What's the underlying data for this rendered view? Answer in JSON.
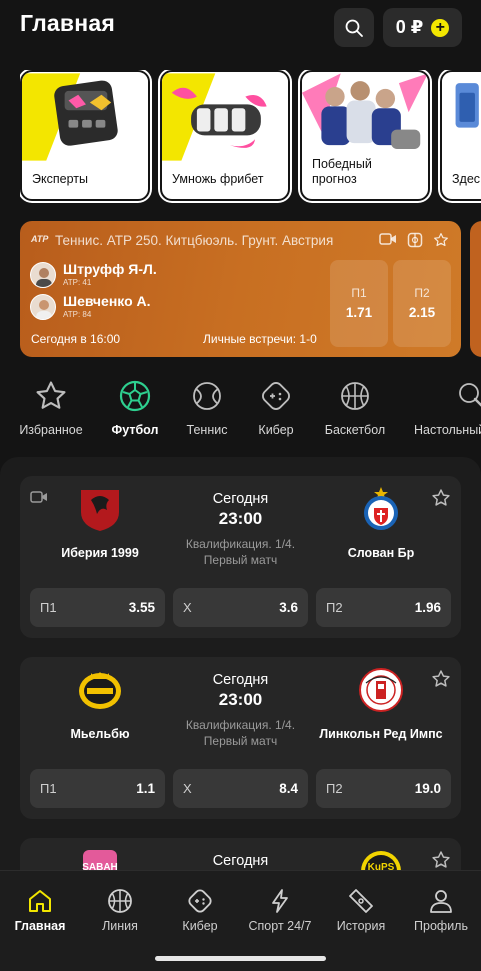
{
  "header": {
    "title": "Главная",
    "balance": "0 ₽",
    "plus": "+"
  },
  "stories": [
    {
      "label": "Эксперты"
    },
    {
      "label": "Умножь фрибет"
    },
    {
      "label": "Победный\nпрогноз"
    },
    {
      "label": "Здес"
    }
  ],
  "live": {
    "atp_logo": "ATP",
    "tournament": "Теннис. ATP 250. Китцбюэль. Грунт. Австрия",
    "player1": {
      "name": "Штруфф Я-Л.",
      "rank": "ATP: 41"
    },
    "player2": {
      "name": "Шевченко А.",
      "rank": "ATP: 84"
    },
    "time": "Сегодня в 16:00",
    "h2h": "Личные встречи: 1-0",
    "odds": [
      {
        "label": "П1",
        "value": "1.71"
      },
      {
        "label": "П2",
        "value": "2.15"
      }
    ]
  },
  "sports": [
    {
      "label": "Избранное"
    },
    {
      "label": "Футбол"
    },
    {
      "label": "Теннис"
    },
    {
      "label": "Кибер"
    },
    {
      "label": "Баскетбол"
    },
    {
      "label": "Настольный"
    }
  ],
  "matches": [
    {
      "day": "Сегодня",
      "time": "23:00",
      "stage1": "Квалификация. 1/4.",
      "stage2": "Первый матч",
      "home": "Иберия 1999",
      "away": "Слован Бр",
      "odds": [
        {
          "label": "П1",
          "value": "3.55"
        },
        {
          "label": "X",
          "value": "3.6"
        },
        {
          "label": "П2",
          "value": "1.96"
        }
      ]
    },
    {
      "day": "Сегодня",
      "time": "23:00",
      "stage1": "Квалификация. 1/4.",
      "stage2": "Первый матч",
      "home": "Мьельбю",
      "away": "Линкольн Ред Импс",
      "odds": [
        {
          "label": "П1",
          "value": "1.1"
        },
        {
          "label": "X",
          "value": "8.4"
        },
        {
          "label": "П2",
          "value": "19.0"
        }
      ]
    },
    {
      "day": "Сегодня",
      "home_logo_text": "SABAH",
      "away_logo_text": "KuPS"
    }
  ],
  "nav": [
    {
      "label": "Главная"
    },
    {
      "label": "Линия"
    },
    {
      "label": "Кибер"
    },
    {
      "label": "Спорт 24/7"
    },
    {
      "label": "История"
    },
    {
      "label": "Профиль"
    }
  ],
  "colors": {
    "accent": "#f2e600",
    "football": "#2ecf8f",
    "live_card": "#c86f22",
    "background": "#141414"
  }
}
